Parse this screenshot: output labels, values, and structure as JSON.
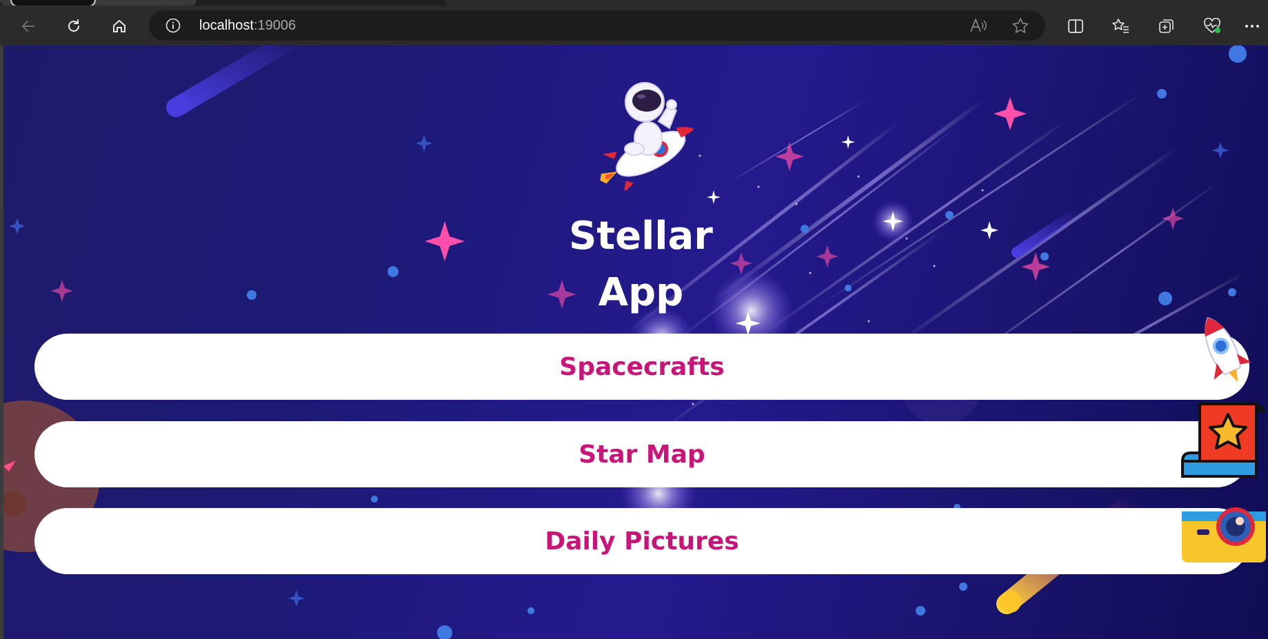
{
  "browser": {
    "url_host": "localhost",
    "url_port": ":19006",
    "icons": [
      "back-icon",
      "refresh-icon",
      "home-icon",
      "site-info-icon",
      "read-aloud-icon",
      "add-favorite-icon",
      "split-screen-icon",
      "favorites-icon",
      "collections-icon",
      "browser-essentials-icon",
      "more-icon"
    ]
  },
  "app": {
    "title_line1": "Stellar",
    "title_line2": "App",
    "buttons": [
      {
        "label": "Spacecrafts",
        "icon": "rocket-icon"
      },
      {
        "label": "Star Map",
        "icon": "star-map-icon"
      },
      {
        "label": "Daily Pictures",
        "icon": "camera-icon"
      }
    ],
    "colors": {
      "button_text": "#c8157a",
      "button_bg": "#ffffff",
      "background": "#1d1a78"
    }
  }
}
